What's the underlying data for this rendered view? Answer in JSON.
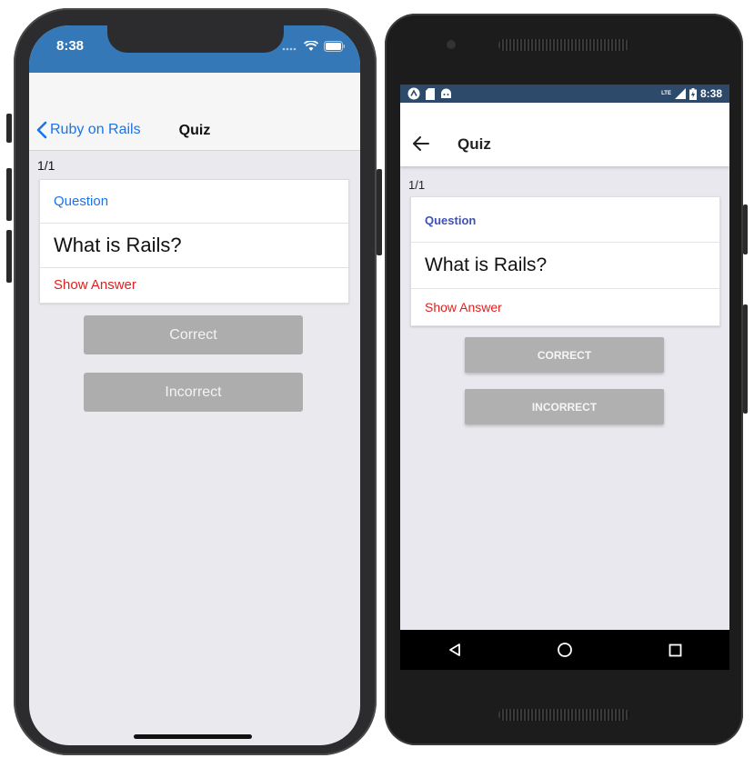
{
  "ios": {
    "status_time": "8:38",
    "nav": {
      "back_label": "Ruby on Rails",
      "title": "Quiz"
    },
    "counter": "1/1",
    "card": {
      "label": "Question",
      "question": "What is Rails?",
      "show_answer": "Show Answer"
    },
    "buttons": {
      "correct": "Correct",
      "incorrect": "Incorrect"
    }
  },
  "android": {
    "status_time": "8:38",
    "status_network": "LTE",
    "appbar": {
      "title": "Quiz"
    },
    "counter": "1/1",
    "card": {
      "label": "Question",
      "question": "What is Rails?",
      "show_answer": "Show Answer"
    },
    "buttons": {
      "correct": "CORRECT",
      "incorrect": "INCORRECT"
    }
  },
  "colors": {
    "ios_status_bar": "#3478b8",
    "ios_link": "#1a73e8",
    "android_status_bar": "#2d4a6b",
    "android_label": "#3f51b5",
    "show_answer": "#e02020",
    "button_bg": "#adadad"
  }
}
